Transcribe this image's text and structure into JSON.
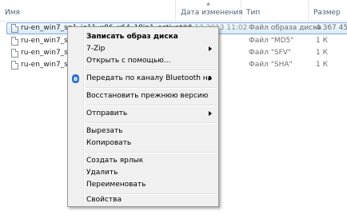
{
  "columns": {
    "name": "Имя",
    "date": "Дата изменения",
    "type": "Тип",
    "size": "Размер",
    "sort_indicator": "▲"
  },
  "files": [
    {
      "name": "ru-en_win7_sp1_ie11_x86_x64_18in1_activated",
      "date": "20.12.2013 11:02",
      "type": "Файл образа диска",
      "size": "4 367 456 К",
      "icon": "disc-image-icon",
      "selected": true
    },
    {
      "name": "ru-en_win7_sp1",
      "date": "",
      "type": "Файл \"MD5\"",
      "size": "1 К",
      "icon": "file-icon"
    },
    {
      "name": "ru-en_win7_sp1",
      "date": "",
      "type": "Файл \"SFV\"",
      "size": "1 К",
      "icon": "file-icon"
    },
    {
      "name": "ru-en_win7_sp1",
      "date": "",
      "type": "Файл \"SHA\"",
      "size": "1 К",
      "icon": "file-icon"
    }
  ],
  "context_menu": {
    "burn": "Записать образ диска",
    "sevenzip": "7-Zip",
    "open_with": "Открыть с помощью...",
    "bluetooth": "Передать по каналу Bluetooth на",
    "restore": "Восстановить прежнюю версию",
    "send_to": "Отправить",
    "cut": "Вырезать",
    "copy": "Копировать",
    "create_shortcut": "Создать ярлык",
    "delete": "Удалить",
    "rename": "Переименовать",
    "properties": "Свойства"
  },
  "colors": {
    "selection_border": "#84acdd",
    "header_text": "#4c607a",
    "bluetooth": "#2a6fd0"
  }
}
